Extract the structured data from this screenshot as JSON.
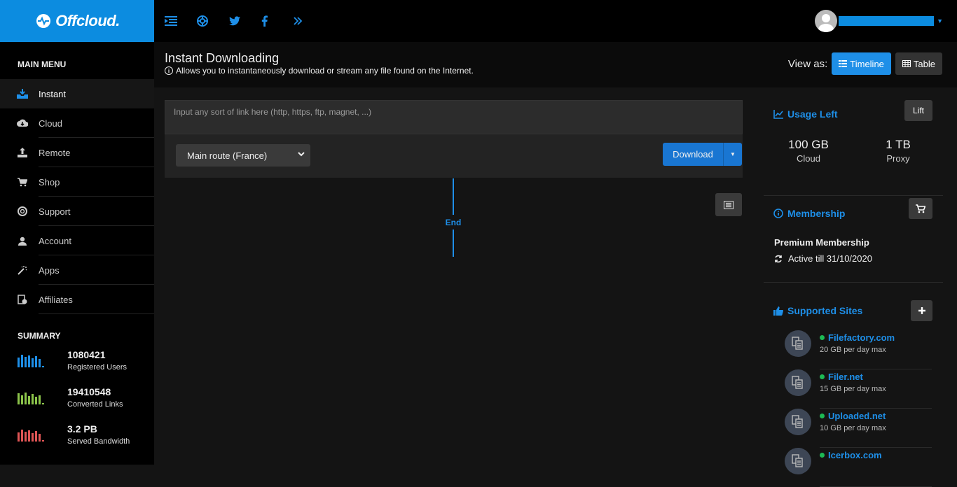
{
  "brand": {
    "name": "Offcloud."
  },
  "sidebar": {
    "menu_title": "MAIN MENU",
    "items": [
      {
        "label": "Instant",
        "icon": "download-tray-icon",
        "active": true
      },
      {
        "label": "Cloud",
        "icon": "cloud-download-icon"
      },
      {
        "label": "Remote",
        "icon": "upload-icon"
      },
      {
        "label": "Shop",
        "icon": "cart-icon"
      },
      {
        "label": "Support",
        "icon": "lifebuoy-icon"
      },
      {
        "label": "Account",
        "icon": "user-icon"
      },
      {
        "label": "Apps",
        "icon": "magic-wand-icon"
      },
      {
        "label": "Affiliates",
        "icon": "money-icon"
      }
    ],
    "summary_title": "SUMMARY",
    "stats": [
      {
        "value": "1080421",
        "label": "Registered Users",
        "color": "#1e8fe8"
      },
      {
        "value": "19410548",
        "label": "Converted Links",
        "color": "#8bc34a"
      },
      {
        "value": "3.2 PB",
        "label": "Served Bandwidth",
        "color": "#e05555"
      }
    ]
  },
  "header": {
    "title": "Instant Downloading",
    "subtitle": "Allows you to instantaneously download or stream any file found on the Internet.",
    "view_as_label": "View as:",
    "timeline_label": "Timeline",
    "table_label": "Table"
  },
  "download": {
    "placeholder": "Input any sort of link here (http, https, ftp, magnet, ...)",
    "route": "Main route (France)",
    "button_label": "Download"
  },
  "timeline": {
    "end_label": "End"
  },
  "usage": {
    "title": "Usage Left",
    "lift_label": "Lift",
    "cloud_value": "100 GB",
    "cloud_label": "Cloud",
    "proxy_value": "1 TB",
    "proxy_label": "Proxy"
  },
  "membership": {
    "title": "Membership",
    "name": "Premium Membership",
    "status": "Active till 31/10/2020"
  },
  "supported_sites": {
    "title": "Supported Sites",
    "sites": [
      {
        "name": "Filefactory.com",
        "quota": "20 GB per day max"
      },
      {
        "name": "Filer.net",
        "quota": "15 GB per day max"
      },
      {
        "name": "Uploaded.net",
        "quota": "10 GB per day max"
      },
      {
        "name": "Icerbox.com",
        "quota": ""
      }
    ]
  },
  "colors": {
    "accent": "#1e8fe8",
    "brand_bg": "#0c8ce0",
    "status_ok": "#1db954"
  }
}
